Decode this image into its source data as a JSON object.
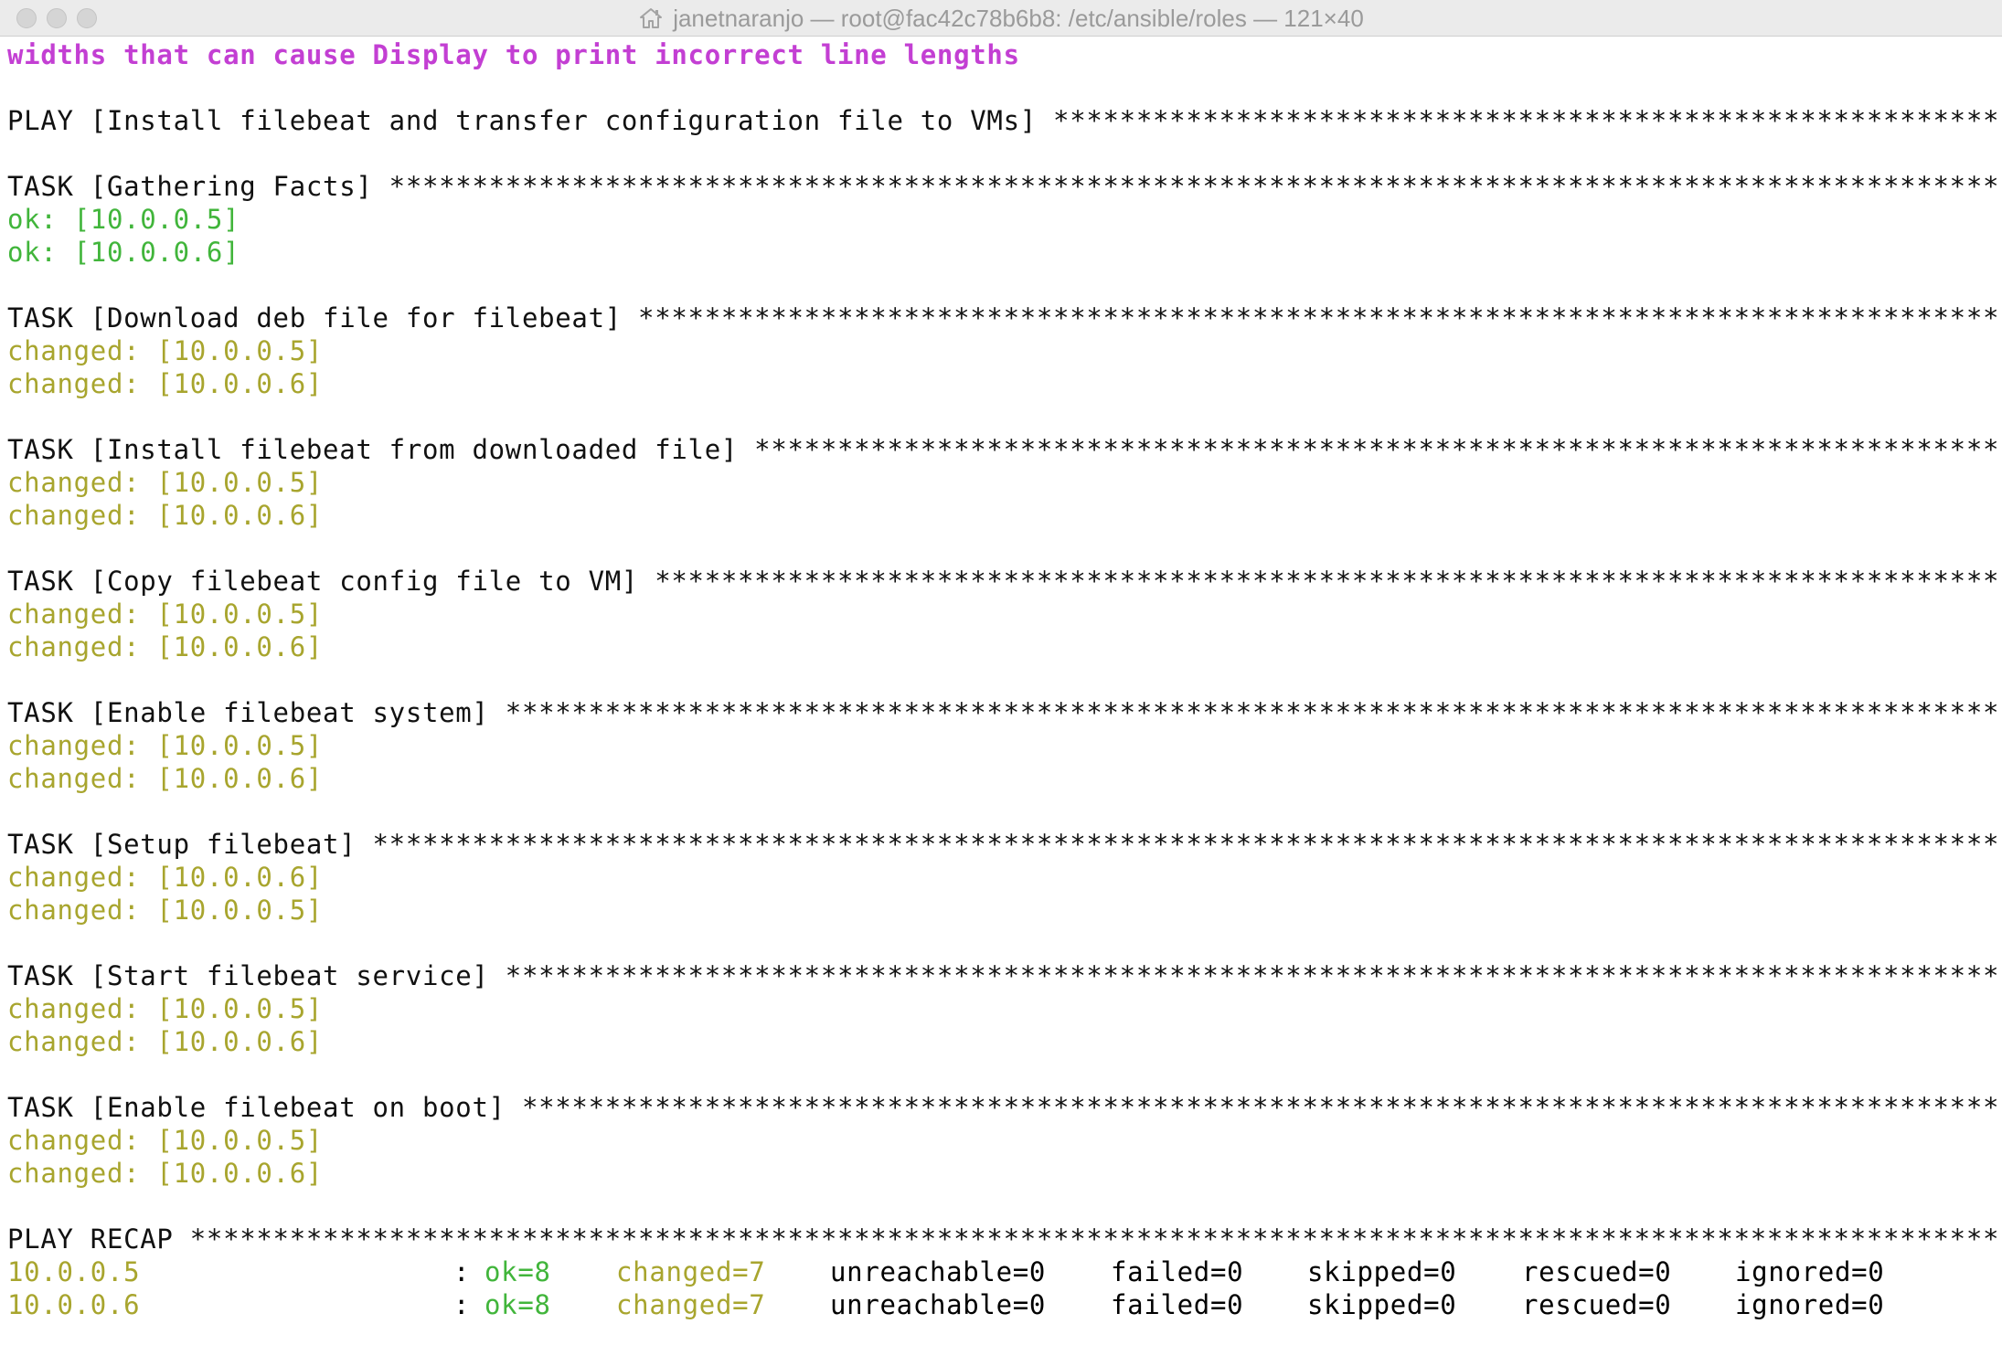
{
  "window": {
    "title": "janetnaranjo — root@fac42c78b6b8: /etc/ansible/roles — 121×40",
    "title_icon": "home-icon"
  },
  "colors": {
    "warning": "#c33fd3",
    "ok": "#41b53b",
    "changed": "#a8a52e",
    "text": "#111111"
  },
  "terminal": {
    "warning_line": "widths that can cause Display to print incorrect line lengths",
    "play_header": "PLAY [Install filebeat and transfer configuration file to VMs] *****************************************************************",
    "tasks": [
      {
        "header": "TASK [Gathering Facts] ************************************************************************************************************************",
        "results": [
          "ok: [10.0.0.5]",
          "ok: [10.0.0.6]"
        ],
        "status": "ok"
      },
      {
        "header": "TASK [Download deb file for filebeat] **********************************************************************************************************",
        "results": [
          "changed: [10.0.0.5]",
          "changed: [10.0.0.6]"
        ],
        "status": "changed"
      },
      {
        "header": "TASK [Install filebeat from downloaded file] ***********************************************************************************************",
        "results": [
          "changed: [10.0.0.5]",
          "changed: [10.0.0.6]"
        ],
        "status": "changed"
      },
      {
        "header": "TASK [Copy filebeat config file to VM] *********************************************************************************************************",
        "results": [
          "changed: [10.0.0.5]",
          "changed: [10.0.0.6]"
        ],
        "status": "changed"
      },
      {
        "header": "TASK [Enable filebeat system] *************************************************************************************************************",
        "results": [
          "changed: [10.0.0.5]",
          "changed: [10.0.0.6]"
        ],
        "status": "changed"
      },
      {
        "header": "TASK [Setup filebeat] *****************************************************************************************************************",
        "results": [
          "changed: [10.0.0.6]",
          "changed: [10.0.0.5]"
        ],
        "status": "changed"
      },
      {
        "header": "TASK [Start filebeat service] *************************************************************************************************************",
        "results": [
          "changed: [10.0.0.5]",
          "changed: [10.0.0.6]"
        ],
        "status": "changed"
      },
      {
        "header": "TASK [Enable filebeat on boot] ************************************************************************************************************",
        "results": [
          "changed: [10.0.0.5]",
          "changed: [10.0.0.6]"
        ],
        "status": "changed"
      }
    ],
    "recap_header": "PLAY RECAP *****************************************************************************************************************************",
    "recap": [
      {
        "host": "10.0.0.5",
        "colon": ":",
        "ok": "ok=8",
        "changed": "changed=7",
        "unreachable": "unreachable=0",
        "failed": "failed=0",
        "skipped": "skipped=0",
        "rescued": "rescued=0",
        "ignored": "ignored=0"
      },
      {
        "host": "10.0.0.6",
        "colon": ":",
        "ok": "ok=8",
        "changed": "changed=7",
        "unreachable": "unreachable=0",
        "failed": "failed=0",
        "skipped": "skipped=0",
        "rescued": "rescued=0",
        "ignored": "ignored=0"
      }
    ]
  }
}
